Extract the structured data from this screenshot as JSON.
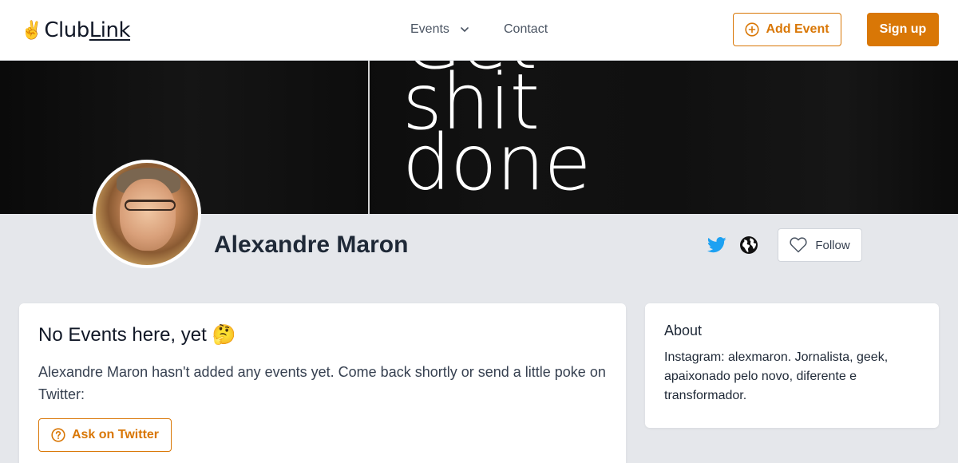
{
  "header": {
    "logo": {
      "hand_emoji": "✌️",
      "text_main": "Club",
      "text_link": "Link"
    },
    "nav": {
      "events_label": "Events",
      "contact_label": "Contact"
    },
    "add_event_label": "Add Event",
    "signup_label": "Sign up"
  },
  "banner": {
    "lines": [
      "Get",
      "shit",
      "done"
    ]
  },
  "profile": {
    "name": "Alexandre Maron",
    "follow_label": "Follow"
  },
  "events_card": {
    "title": "No Events here, yet 🤔",
    "message": "Alexandre Maron hasn't added any events yet. Come back shortly or send a little poke on Twitter:",
    "ask_label": "Ask on Twitter"
  },
  "about_card": {
    "title": "About",
    "text": "Instagram: alexmaron. Jornalista, geek, apaixonado pelo novo, diferente e transformador."
  },
  "colors": {
    "accent": "#d97706",
    "twitter": "#1da1f2",
    "page_bg": "#e5e7eb"
  },
  "icons": [
    "peace-hand-icon",
    "chevron-down-icon",
    "plus-circle-icon",
    "twitter-icon",
    "globe-icon",
    "heart-icon",
    "question-circle-icon"
  ]
}
